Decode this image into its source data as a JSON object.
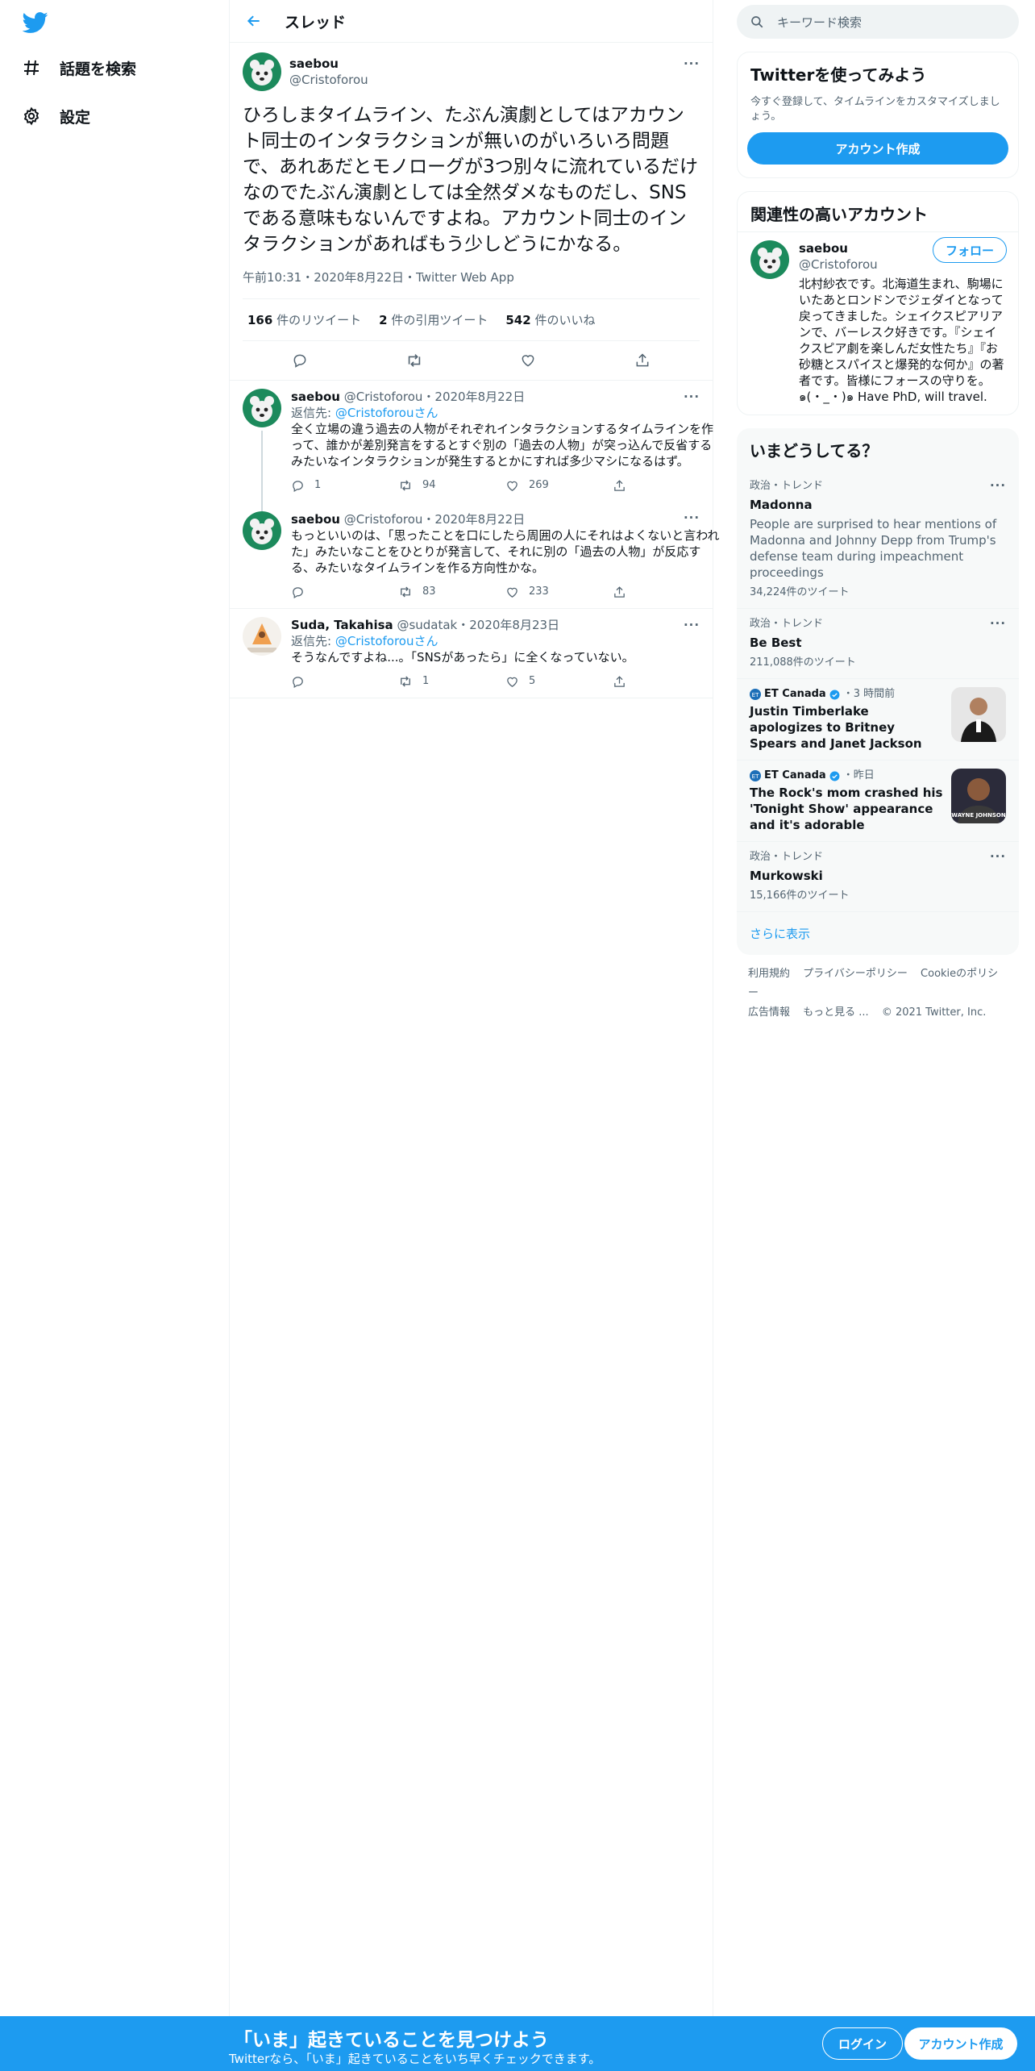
{
  "nav": {
    "explore_label": "話題を検索",
    "settings_label": "設定"
  },
  "header": {
    "title": "スレッド"
  },
  "main_tweet": {
    "display_name": "saebou",
    "username": "@Cristoforou",
    "text": "ひろしまタイムライン、たぶん演劇としてはアカウント同士のインタラクションが無いのがいろいろ問題で、あれあだとモノローグが3つ別々に流れているだけなのでたぶん演劇としては全然ダメなものだし、SNSである意味もないんですよね。アカウント同士のインタラクションがあればもう少しどうにかなる。",
    "meta": "午前10:31・2020年8月22日・Twitter Web App",
    "retweets": "166",
    "retweets_label": "件のリツイート",
    "quotes": "2",
    "quotes_label": "件の引用ツイート",
    "likes": "542",
    "likes_label": "件のいいね"
  },
  "replies": [
    {
      "display_name": "saebou",
      "username": "@Cristoforou",
      "date": "・2020年8月22日",
      "replying_prefix": "返信先: ",
      "replying_to": "@Cristoforou",
      "replying_suffix": "さん",
      "text": "全く立場の違う過去の人物がそれぞれインタラクションするタイムラインを作って、誰かが差別発言をするとすぐ別の「過去の人物」が突っ込んで反省するみたいなインタラクションが発生するとかにすれば多少マシになるはず。",
      "reply_count": "1",
      "retweet_count": "94",
      "like_count": "269"
    },
    {
      "display_name": "saebou",
      "username": "@Cristoforou",
      "date": "・2020年8月22日",
      "text": "もっといいのは、「思ったことを口にしたら周囲の人にそれはよくないと言われた」みたいなことをひとりが発言して、それに別の「過去の人物」が反応する、みたいなタイムラインを作る方向性かな。",
      "reply_count": "",
      "retweet_count": "83",
      "like_count": "233"
    },
    {
      "display_name": "Suda, Takahisa",
      "username": "@sudatak",
      "date": "・2020年8月23日",
      "replying_prefix": "返信先: ",
      "replying_to": "@Cristoforou",
      "replying_suffix": "さん",
      "text": "そうなんですよね...。「SNSがあったら」に全くなっていない。",
      "reply_count": "",
      "retweet_count": "1",
      "like_count": "5"
    }
  ],
  "search": {
    "placeholder": "キーワード検索"
  },
  "signup_box": {
    "title": "Twitterを使ってみよう",
    "subtitle": "今すぐ登録して、タイムラインをカスタマイズしましょう。",
    "button": "アカウント作成"
  },
  "related": {
    "title": "関連性の高いアカウント",
    "display_name": "saebou",
    "username": "@Cristoforou",
    "follow": "フォロー",
    "bio": "北村紗衣です。北海道生まれ、駒場にいたあとロンドンでジェダイとなって戻ってきました。シェイクスピアリアンで、バーレスク好きです。『シェイクスピア劇を楽しんだ女性たち』『お砂糖とスパイスと爆発的な何か』の著者です。皆様にフォースの守りを。๑(・_・)๑ Have PhD, will travel."
  },
  "trends": {
    "title": "いまどうしてる？",
    "items": [
      {
        "context": "政治・トレンド",
        "name": "Madonna",
        "desc": "People are surprised to hear mentions of Madonna and Johnny Depp from Trump's defense team during impeachment proceedings",
        "count": "34,224件のツイート"
      },
      {
        "context": "政治・トレンド",
        "name": "Be Best",
        "desc": "",
        "count": "211,088件のツイート"
      }
    ],
    "news": [
      {
        "source": "ET Canada",
        "time": "・3 時間前",
        "headline": "Justin Timberlake apologizes to Britney Spears and Janet Jackson"
      },
      {
        "source": "ET Canada",
        "time": "・昨日",
        "headline": "The Rock's mom crashed his 'Tonight Show' appearance and it's adorable",
        "thumb_text": "WAYNE JOHNSON"
      }
    ],
    "last": {
      "context": "政治・トレンド",
      "name": "Murkowski",
      "count": "15,166件のツイート"
    },
    "show_more": "さらに表示"
  },
  "footer": {
    "terms": "利用規約",
    "privacy": "プライバシーポリシー",
    "cookie": "Cookieのポリシー",
    "ads": "広告情報",
    "more": "もっと見る ...",
    "copyright": "© 2021 Twitter, Inc."
  },
  "bottom_bar": {
    "title": "「いま」起きていることを見つけよう",
    "subtitle": "Twitterなら、「いま」起きていることをいち早くチェックできます。",
    "login": "ログイン",
    "signup": "アカウント作成"
  },
  "colors": {
    "accent": "#1d9bf0",
    "text": "#0f1419",
    "muted": "#536471"
  }
}
